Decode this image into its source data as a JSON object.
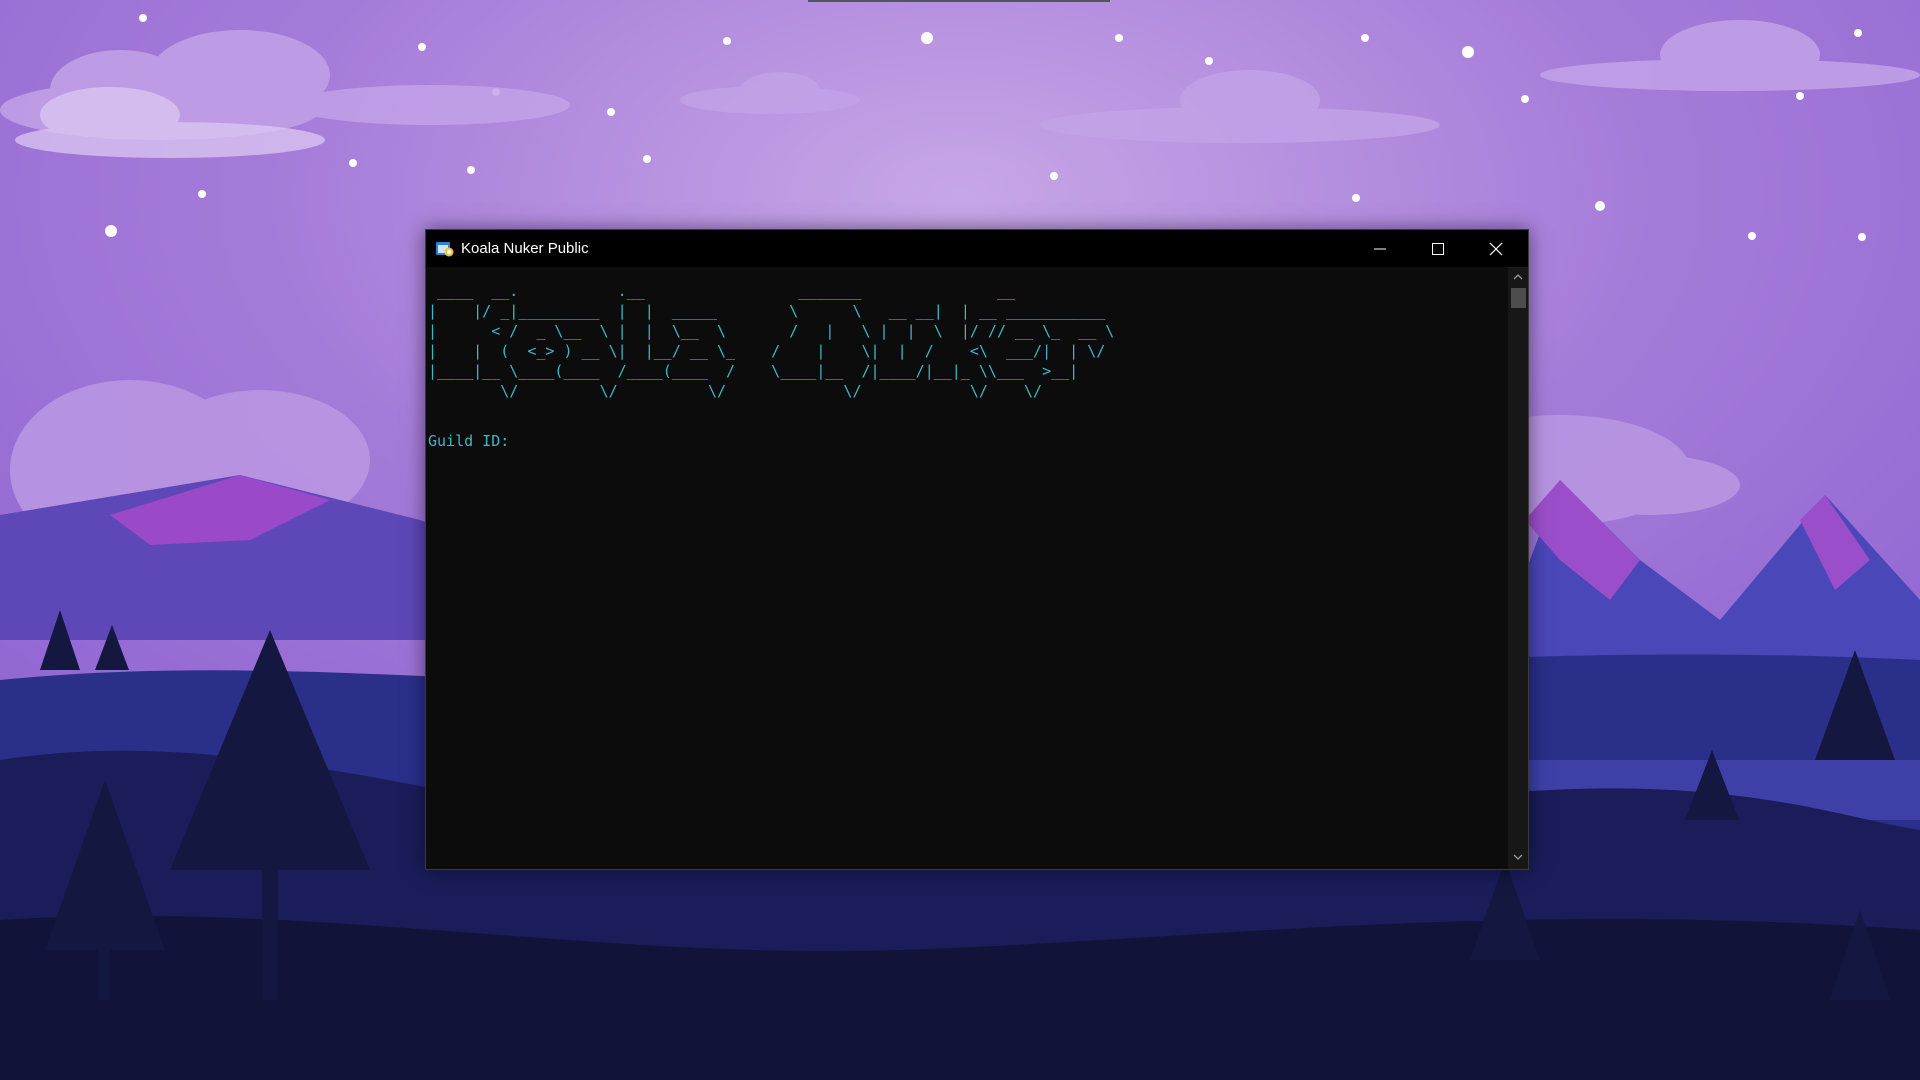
{
  "window": {
    "title": "Koala Nuker Public",
    "controls": [
      "minimize-icon",
      "maximize-icon",
      "close-icon"
    ]
  },
  "console": {
    "banner": " ____  __.           .__                 _______               __\n|    |/ _|_________  |  |  _____        \\      \\   __ __|  | __ ___________\n|      < /  _ \\__  \\ |  |  \\__  \\       /   |   \\ |  |  \\  |/ // __ \\_  __ \\\n|    |  (  <_> ) __ \\|  |__/ __ \\_    /    |    \\|  |  /    <\\  ___/|  | \\/\n|____|__ \\____(____  /____(____  /    \\____|__  /|____/|__|_ \\\\___  >__|\n        \\/         \\/          \\/             \\/            \\/    \\/",
    "prompt": "Guild ID:",
    "text_color": "#3bb8c8",
    "background_color": "#0c0c0c"
  },
  "desktop": {
    "wallpaper": "purple-night-mountains"
  }
}
